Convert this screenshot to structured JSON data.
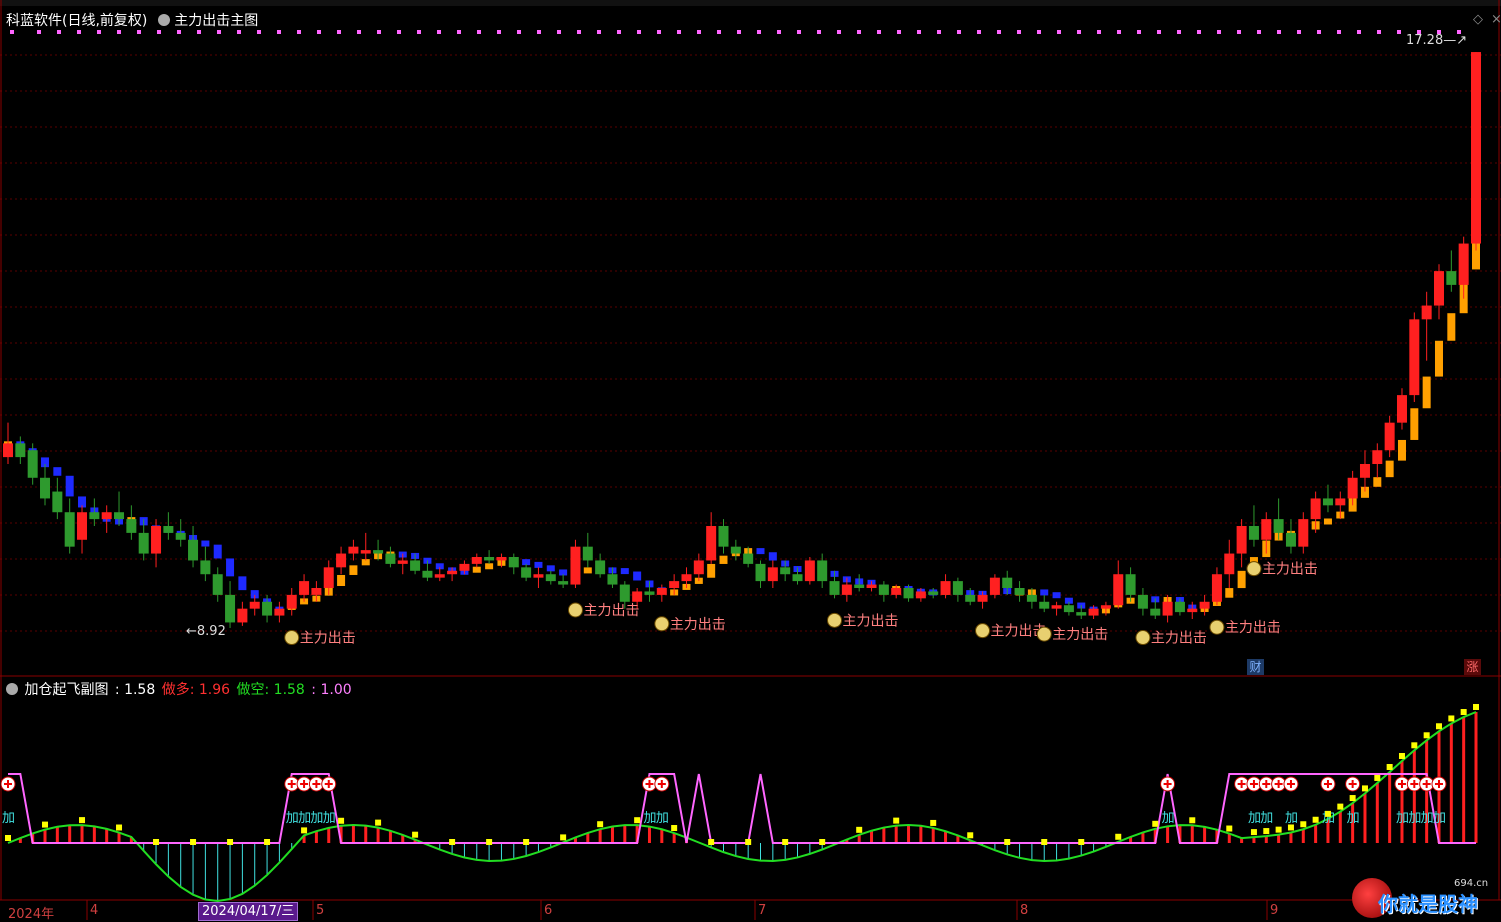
{
  "main_chart": {
    "app_name": "科蓝软件",
    "mode": "(日线,前复权)",
    "indicator_name": "主力出击主图",
    "high_label": "17.28",
    "low_label": "8.92",
    "signal_label": "主力出击",
    "badge_cai": "财",
    "badge_zhang": "涨"
  },
  "sub_chart": {
    "name": "加仓起飞副图",
    "value_text": ": 1.58",
    "buy_label": "做多: 1.96",
    "sell_label": "做空: 1.58",
    "extra_label": ": 1.00",
    "add_label": "加"
  },
  "x_axis": {
    "year_label": "2024年",
    "months": [
      "4",
      "5",
      "6",
      "7",
      "8",
      "9"
    ],
    "selected_date": "2024/04/17/三"
  },
  "watermark": {
    "text": "你就是股神",
    "site": "694.cn"
  },
  "colors": {
    "up": "#ff2020",
    "down": "#2e9a2e",
    "ma_orange": "#ffa000",
    "ma_blue": "#1e2aff",
    "pink": "#ff66ff",
    "cyan": "#40e0e0",
    "green_line": "#22dd22",
    "red_line": "#ff2020",
    "yellow": "#ffff00",
    "grid": "#5a0000"
  },
  "chart_data": {
    "type": "candlestick",
    "price_range": [
      8.92,
      17.28
    ],
    "candles": [
      [
        11.4,
        11.9,
        11.3,
        11.6
      ],
      [
        11.6,
        11.7,
        11.3,
        11.4
      ],
      [
        11.5,
        11.6,
        11.0,
        11.1
      ],
      [
        11.1,
        11.3,
        10.7,
        10.8
      ],
      [
        10.9,
        11.1,
        10.5,
        10.6
      ],
      [
        10.6,
        10.8,
        10.0,
        10.1
      ],
      [
        10.2,
        10.7,
        10.0,
        10.6
      ],
      [
        10.6,
        10.8,
        10.4,
        10.5
      ],
      [
        10.5,
        10.7,
        10.3,
        10.6
      ],
      [
        10.6,
        10.9,
        10.4,
        10.5
      ],
      [
        10.5,
        10.7,
        10.2,
        10.3
      ],
      [
        10.3,
        10.5,
        9.9,
        10.0
      ],
      [
        10.0,
        10.5,
        9.8,
        10.4
      ],
      [
        10.4,
        10.6,
        10.2,
        10.3
      ],
      [
        10.3,
        10.5,
        10.1,
        10.2
      ],
      [
        10.2,
        10.4,
        9.8,
        9.9
      ],
      [
        9.9,
        10.1,
        9.6,
        9.7
      ],
      [
        9.7,
        9.8,
        9.3,
        9.4
      ],
      [
        9.4,
        9.6,
        8.92,
        9.0
      ],
      [
        9.0,
        9.3,
        8.95,
        9.2
      ],
      [
        9.2,
        9.4,
        9.1,
        9.3
      ],
      [
        9.3,
        9.4,
        9.0,
        9.1
      ],
      [
        9.1,
        9.3,
        9.0,
        9.2
      ],
      [
        9.2,
        9.5,
        9.1,
        9.4
      ],
      [
        9.4,
        9.7,
        9.3,
        9.6
      ],
      [
        9.4,
        9.6,
        9.3,
        9.5
      ],
      [
        9.5,
        9.9,
        9.4,
        9.8
      ],
      [
        9.8,
        10.1,
        9.7,
        10.0
      ],
      [
        10.0,
        10.2,
        9.9,
        10.1
      ],
      [
        10.0,
        10.3,
        9.9,
        10.05
      ],
      [
        10.05,
        10.2,
        9.9,
        10.0
      ],
      [
        10.0,
        10.1,
        9.8,
        9.85
      ],
      [
        9.85,
        10.0,
        9.7,
        9.9
      ],
      [
        9.9,
        10.0,
        9.7,
        9.75
      ],
      [
        9.75,
        9.9,
        9.6,
        9.65
      ],
      [
        9.65,
        9.8,
        9.6,
        9.7
      ],
      [
        9.7,
        9.8,
        9.6,
        9.75
      ],
      [
        9.75,
        9.9,
        9.7,
        9.85
      ],
      [
        9.85,
        10.0,
        9.8,
        9.95
      ],
      [
        9.95,
        10.05,
        9.85,
        9.9
      ],
      [
        9.9,
        10.0,
        9.8,
        9.95
      ],
      [
        9.95,
        10.0,
        9.7,
        9.8
      ],
      [
        9.8,
        9.85,
        9.6,
        9.65
      ],
      [
        9.65,
        9.8,
        9.5,
        9.7
      ],
      [
        9.7,
        9.75,
        9.55,
        9.6
      ],
      [
        9.6,
        9.7,
        9.5,
        9.55
      ],
      [
        9.55,
        10.2,
        9.5,
        10.1
      ],
      [
        10.1,
        10.3,
        9.8,
        9.9
      ],
      [
        9.9,
        10.0,
        9.65,
        9.7
      ],
      [
        9.7,
        9.8,
        9.5,
        9.55
      ],
      [
        9.55,
        9.6,
        9.2,
        9.3
      ],
      [
        9.3,
        9.5,
        9.2,
        9.45
      ],
      [
        9.45,
        9.6,
        9.3,
        9.4
      ],
      [
        9.4,
        9.55,
        9.3,
        9.5
      ],
      [
        9.5,
        9.7,
        9.4,
        9.6
      ],
      [
        9.6,
        9.8,
        9.5,
        9.7
      ],
      [
        9.7,
        10.0,
        9.6,
        9.9
      ],
      [
        9.9,
        10.6,
        9.85,
        10.4
      ],
      [
        10.4,
        10.5,
        10.0,
        10.1
      ],
      [
        10.1,
        10.2,
        9.9,
        10.0
      ],
      [
        10.0,
        10.1,
        9.8,
        9.85
      ],
      [
        9.85,
        9.9,
        9.5,
        9.6
      ],
      [
        9.6,
        9.9,
        9.5,
        9.8
      ],
      [
        9.8,
        9.9,
        9.6,
        9.7
      ],
      [
        9.7,
        9.8,
        9.55,
        9.6
      ],
      [
        9.6,
        9.95,
        9.55,
        9.9
      ],
      [
        9.9,
        10.0,
        9.5,
        9.6
      ],
      [
        9.6,
        9.75,
        9.35,
        9.4
      ],
      [
        9.4,
        9.65,
        9.3,
        9.55
      ],
      [
        9.55,
        9.7,
        9.45,
        9.5
      ],
      [
        9.5,
        9.6,
        9.45,
        9.55
      ],
      [
        9.55,
        9.6,
        9.3,
        9.4
      ],
      [
        9.4,
        9.55,
        9.35,
        9.5
      ],
      [
        9.5,
        9.55,
        9.3,
        9.35
      ],
      [
        9.35,
        9.5,
        9.3,
        9.45
      ],
      [
        9.45,
        9.5,
        9.35,
        9.4
      ],
      [
        9.4,
        9.7,
        9.35,
        9.6
      ],
      [
        9.6,
        9.65,
        9.3,
        9.4
      ],
      [
        9.4,
        9.5,
        9.25,
        9.3
      ],
      [
        9.3,
        9.45,
        9.2,
        9.4
      ],
      [
        9.4,
        9.7,
        9.35,
        9.65
      ],
      [
        9.65,
        9.75,
        9.4,
        9.5
      ],
      [
        9.5,
        9.6,
        9.3,
        9.4
      ],
      [
        9.4,
        9.5,
        9.2,
        9.3
      ],
      [
        9.3,
        9.4,
        9.15,
        9.2
      ],
      [
        9.2,
        9.3,
        9.1,
        9.25
      ],
      [
        9.25,
        9.3,
        9.1,
        9.15
      ],
      [
        9.15,
        9.25,
        9.05,
        9.1
      ],
      [
        9.1,
        9.25,
        9.05,
        9.2
      ],
      [
        9.2,
        9.3,
        9.1,
        9.25
      ],
      [
        9.25,
        9.9,
        9.2,
        9.7
      ],
      [
        9.7,
        9.8,
        9.3,
        9.4
      ],
      [
        9.4,
        9.5,
        9.1,
        9.2
      ],
      [
        9.2,
        9.35,
        9.05,
        9.1
      ],
      [
        9.1,
        9.4,
        9.0,
        9.3
      ],
      [
        9.3,
        9.35,
        9.1,
        9.15
      ],
      [
        9.15,
        9.3,
        9.05,
        9.2
      ],
      [
        9.2,
        9.4,
        9.1,
        9.3
      ],
      [
        9.3,
        9.8,
        9.25,
        9.7
      ],
      [
        9.7,
        10.2,
        9.5,
        10.0
      ],
      [
        10.0,
        10.5,
        9.8,
        10.4
      ],
      [
        10.4,
        10.7,
        10.1,
        10.2
      ],
      [
        10.2,
        10.6,
        10.0,
        10.5
      ],
      [
        10.5,
        10.8,
        10.2,
        10.3
      ],
      [
        10.3,
        10.5,
        10.0,
        10.1
      ],
      [
        10.1,
        10.6,
        10.0,
        10.5
      ],
      [
        10.5,
        10.9,
        10.3,
        10.8
      ],
      [
        10.8,
        11.0,
        10.6,
        10.7
      ],
      [
        10.7,
        10.9,
        10.5,
        10.8
      ],
      [
        10.8,
        11.2,
        10.7,
        11.1
      ],
      [
        11.1,
        11.5,
        10.9,
        11.3
      ],
      [
        11.3,
        11.6,
        11.1,
        11.5
      ],
      [
        11.5,
        12.0,
        11.4,
        11.9
      ],
      [
        11.9,
        12.4,
        11.8,
        12.3
      ],
      [
        12.3,
        13.5,
        12.2,
        13.4
      ],
      [
        13.4,
        13.8,
        12.8,
        13.6
      ],
      [
        13.6,
        14.2,
        13.4,
        14.1
      ],
      [
        14.1,
        14.4,
        13.8,
        13.9
      ],
      [
        13.9,
        14.6,
        13.7,
        14.5
      ],
      [
        14.5,
        17.28,
        14.4,
        17.28
      ]
    ],
    "ma_segments_orange_then_blue": true
  }
}
